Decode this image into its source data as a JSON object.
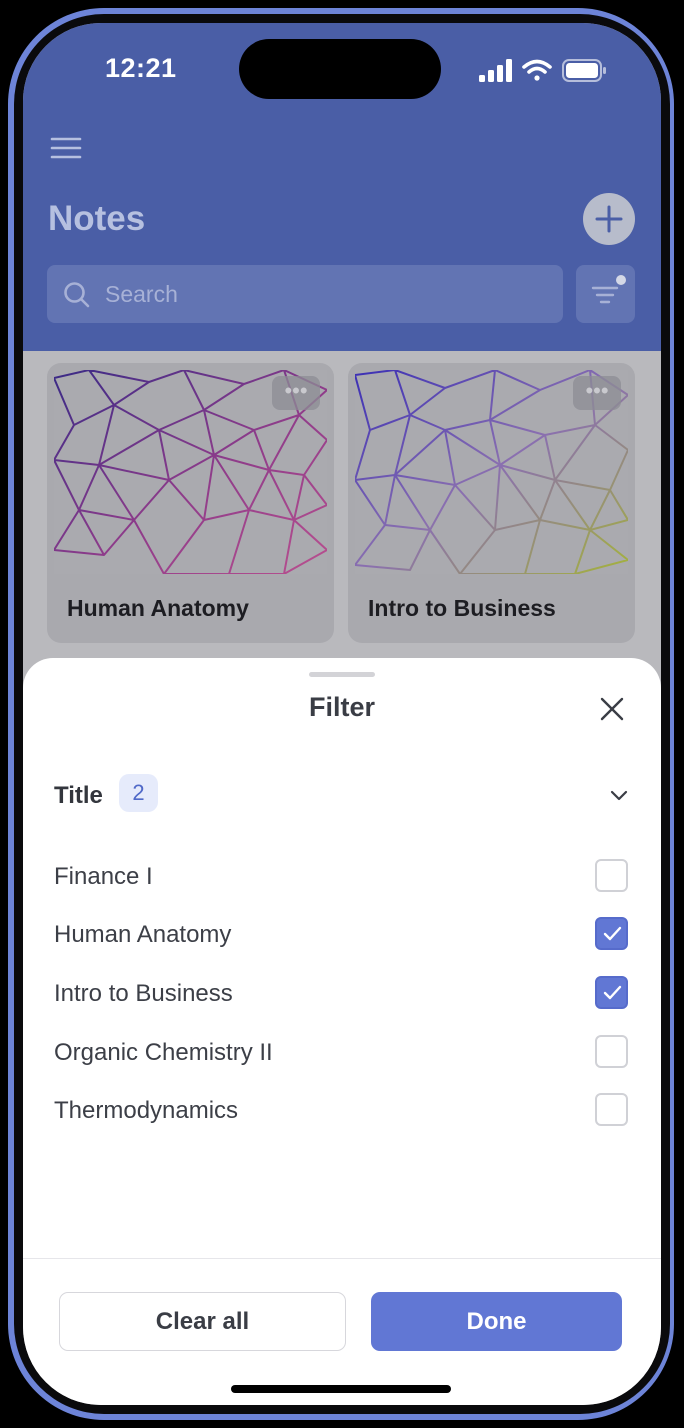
{
  "status_bar": {
    "time": "12:21"
  },
  "header": {
    "title": "Notes",
    "search": {
      "placeholder": "Search",
      "value": ""
    },
    "icons": [
      "hamburger-menu-icon",
      "plus-icon",
      "search-icon",
      "filter-icon"
    ]
  },
  "notes": [
    {
      "title": "Human Anatomy",
      "more_label": "•••",
      "cover_colors": [
        "#3a2a86",
        "#8f3c8a",
        "#b9508f"
      ]
    },
    {
      "title": "Intro to Business",
      "more_label": "•••",
      "cover_colors": [
        "#3b2fb5",
        "#8a6fb0",
        "#a4b33a"
      ]
    }
  ],
  "filter_sheet": {
    "title": "Filter",
    "section": {
      "label": "Title",
      "count": "2",
      "expanded": true
    },
    "options": [
      {
        "label": "Finance I",
        "checked": false
      },
      {
        "label": "Human Anatomy",
        "checked": true
      },
      {
        "label": "Intro to Business",
        "checked": true
      },
      {
        "label": "Organic Chemistry II",
        "checked": false
      },
      {
        "label": "Thermodynamics",
        "checked": false
      }
    ],
    "clear_label": "Clear all",
    "done_label": "Done"
  },
  "colors": {
    "accent": "#6177d4",
    "header_bg": "#4a5ea6",
    "phone_frame": "#6d84d8"
  }
}
